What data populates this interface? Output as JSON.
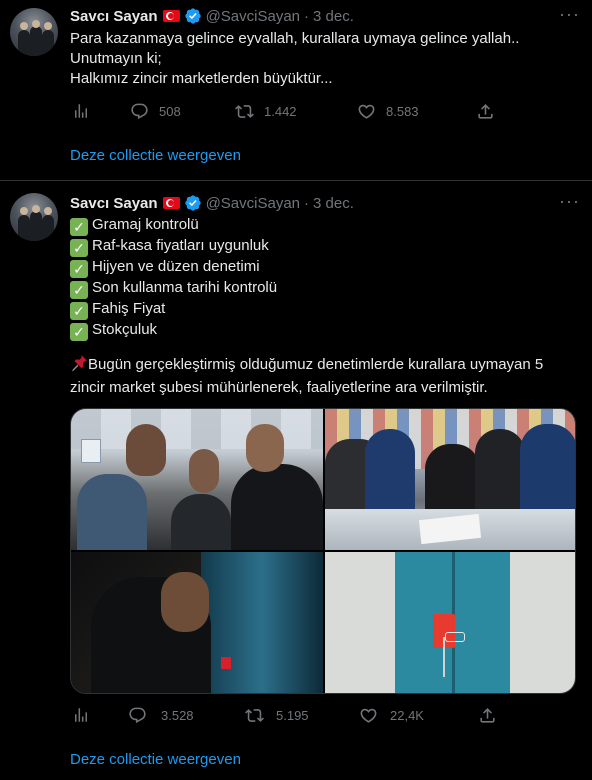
{
  "tweets": [
    {
      "name": "Savcı Sayan",
      "handle": "@SavciSayan",
      "time": "3 dec.",
      "lines": [
        "Para kazanmaya gelince eyvallah, kurallara uymaya gelince yallah..",
        "Unutmayın ki;",
        "Halkımız zincir marketlerden büyüktür..."
      ],
      "replies": "508",
      "retweets": "1.442",
      "likes": "8.583",
      "show_collection": "Deze collectie weergeven"
    },
    {
      "name": "Savcı Sayan",
      "handle": "@SavciSayan",
      "time": "3 dec.",
      "checklist": [
        "Gramaj kontrolü",
        "Raf-kasa fiyatları uygunluk",
        "Hijyen ve düzen denetimi",
        "Son kullanma tarihi kontrolü",
        "Fahiş Fiyat",
        "Stokçuluk"
      ],
      "body_lines": [
        "Bugün gerçekleştirmiş olduğumuz denetimlerde kurallara uymayan 5",
        "zincir market şubesi mühürlenerek, faaliyetlerine ara verilmiştir."
      ],
      "replies": "3.528",
      "retweets": "5.195",
      "likes": "22,4K",
      "show_collection": "Deze collectie weergeven"
    }
  ],
  "icons": {
    "more": "more-icon",
    "verified": "verified-badge-icon",
    "flag": "turkey-flag-icon",
    "analytics": "analytics-icon",
    "reply": "reply-icon",
    "retweet": "retweet-icon",
    "like": "like-icon",
    "share": "share-icon",
    "check": "check-mark-emoji",
    "pin": "pushpin-emoji"
  },
  "colors": {
    "background": "#000000",
    "text": "#e7e9ea",
    "muted": "#71767b",
    "link": "#1d9bf0",
    "divider": "#2f3336",
    "verified": "#1d9bf0",
    "check": "#77b255"
  }
}
